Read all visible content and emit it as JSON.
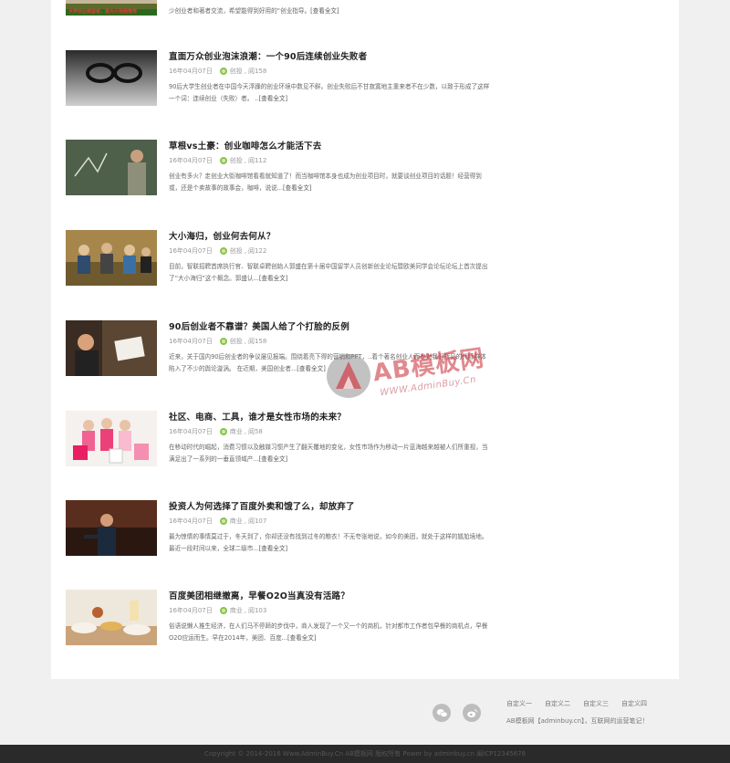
{
  "articles": [
    {
      "title": "",
      "date": "",
      "category": "",
      "views": "",
      "summary": "少创业者和著者交流，希望能得到好用的“创业指导。",
      "more": "[查看全文]",
      "thumb_caption": "大学创业典型者，做大小场我推荐"
    },
    {
      "title": "直面万众创业泡沫浪潮：一个90后连续创业失败者",
      "date": "16年04月07日",
      "category": "创投",
      "views": "阅158",
      "summary": "90后大学生创业者在中国今天浮躁的创业环境中数见不鲜。创业失败后不甘寂寞地主重来者不在少数，以致于形成了这样一个词：连续创业（失败）者。 ..",
      "more": "[查看全文]"
    },
    {
      "title": "草根vs土豪：创业咖啡怎么才能活下去",
      "date": "16年04月07日",
      "category": "创投",
      "views": "阅112",
      "summary": "创业有多火？走创业大街咖啡馆看看就知道了！而当咖啡馆本身也成为创业项目时，就要谈创业项目的话题！经营得到或，还是个卖故事的故事会，咖啡，说说...",
      "more": "[查看全文]"
    },
    {
      "title": "大小海归，创业何去何从？",
      "date": "16年04月07日",
      "category": "创投",
      "views": "阅122",
      "summary": "目前，智联招聘首席执行官、智联卓聘创始人郭盛在第十届中国留学人员创新创业论坛暨欧美同学会论坛论坛上首次提出了“大小海归”这个概念。郭盛认...",
      "more": "[查看全文]"
    },
    {
      "title": "90后创业者不靠谱？美国人给了个打脸的反例",
      "date": "16年04月07日",
      "category": "创投",
      "views": "阅158",
      "summary": "近来，关于国内90后创业者的争议屡见报端。围绕着亮下得的营销和PPT，..着个著名创业人而也对我们所见的代际群体陷入了不少的舆论漩涡。 在近期，美国创业者...",
      "more": "[查看全文]"
    },
    {
      "title": "社区、电商、工具，谁才是女性市场的未来？",
      "date": "16年04月07日",
      "category": "商业",
      "views": "阅58",
      "summary": "在移动时代的崛起，消费习惯以及触媒习惯产生了翻天覆地的变化，女性市场作为移动一片蓝海越来越被人们所重视，当满足出了一系列的一垂直领域产...",
      "more": "[查看全文]"
    },
    {
      "title": "投资人为何选择了百度外卖和饿了么，却放弃了",
      "date": "16年04月07日",
      "category": "商业",
      "views": "阅107",
      "summary": "最为惊情的事情莫过于，冬天到了，你却还没有找到过冬的粮衣！不无夸张地说，如今的美团，就处于这样的尴尬境地。 最近一段时间以来，全球二级市...",
      "more": "[查看全文]"
    },
    {
      "title": "百度美团相继撤离，早餐O2O当真没有活路？",
      "date": "16年04月07日",
      "category": "商业",
      "views": "阅103",
      "summary": "俗语说懒人推生经济，在人们马不停蹄的步伐中，商人发现了一个又一个的商机，针对都市工作者包早餐的商机点，早餐O2O应运而生。早在2014年，美团、百度...",
      "more": "[查看全文]"
    }
  ],
  "watermark": {
    "logo_text": "AB模板网",
    "url": "WWW.AdminBuy.Cn"
  },
  "footer": {
    "links": [
      "自定义一",
      "自定义二",
      "自定义三",
      "自定义四"
    ],
    "line": "AB模板网【adminbuy.cn】，互联网的运营笔记！",
    "social_icons": [
      "wechat-icon",
      "weibo-icon"
    ],
    "copyright": "Copyright © 2014-2016 Www.AdminBuy.Cn AB模板网 版权所有 Power by adminbuy.cn 闽ICP12345678"
  }
}
